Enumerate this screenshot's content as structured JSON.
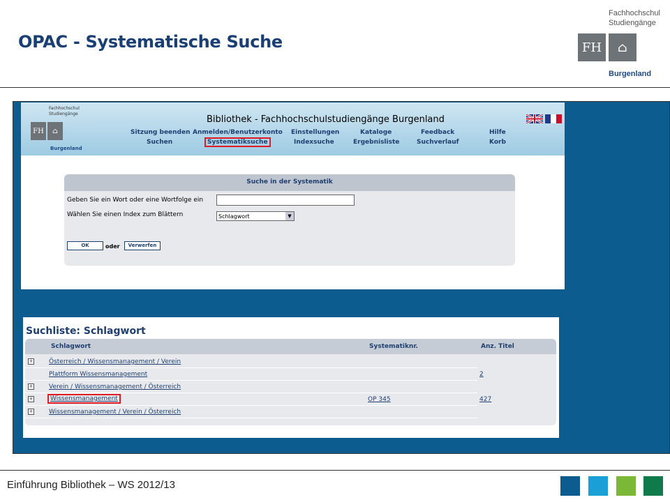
{
  "slide": {
    "title": "OPAC - Systematische Suche",
    "footer": "Einführung Bibliothek – WS 2012/13",
    "logo": {
      "line1": "Fachhochschul",
      "line2": "Studiengänge",
      "bottom": "Burgenland",
      "box1": "FH",
      "box2": "⌂"
    },
    "footer_squares": [
      "#0d5c90",
      "#1a9fd6",
      "#7cb838",
      "#0f7a4a"
    ]
  },
  "opac": {
    "title": "Bibliothek - Fachhochschulstudiengänge Burgenland",
    "logo": {
      "line1": "Fachhochschul",
      "line2": "Studiengänge",
      "bottom": "Burgenland",
      "box1": "FH",
      "box2": "⌂"
    },
    "nav_row1": [
      "Sitzung beenden",
      "Anmelden/Benutzerkonto",
      "Einstellungen",
      "Kataloge",
      "Feedback",
      "Hilfe"
    ],
    "nav_row2": [
      "Suchen",
      "Systematiksuche",
      "Indexsuche",
      "Ergebnisliste",
      "Suchverlauf",
      "Korb"
    ],
    "search": {
      "heading": "Suche in der Systematik",
      "word_label": "Geben Sie ein Wort oder eine Wortfolge ein",
      "word_value": "",
      "index_label": "Wählen Sie einen Index zum Blättern",
      "index_value": "Schlagwort",
      "ok": "OK",
      "oder": "oder",
      "reset": "Verwerfen"
    }
  },
  "list": {
    "title": "Suchliste: Schlagwort",
    "columns": [
      "Schlagwort",
      "Systematiknr.",
      "Anz. Titel"
    ],
    "rows": [
      {
        "expand": true,
        "term": "Österreich / Wissensmanagement / Verein",
        "sysnr": "",
        "count": ""
      },
      {
        "expand": false,
        "term": "Plattform Wissensmanagement",
        "sysnr": "",
        "count": "2"
      },
      {
        "expand": true,
        "term": "Verein / Wissensmanagement / Österreich",
        "sysnr": "",
        "count": ""
      },
      {
        "expand": true,
        "term": "Wissensmanagement",
        "sysnr": "OP 345",
        "count": "427"
      },
      {
        "expand": true,
        "term": "Wissensmanagement / Verein / Österreich",
        "sysnr": "",
        "count": ""
      }
    ]
  }
}
